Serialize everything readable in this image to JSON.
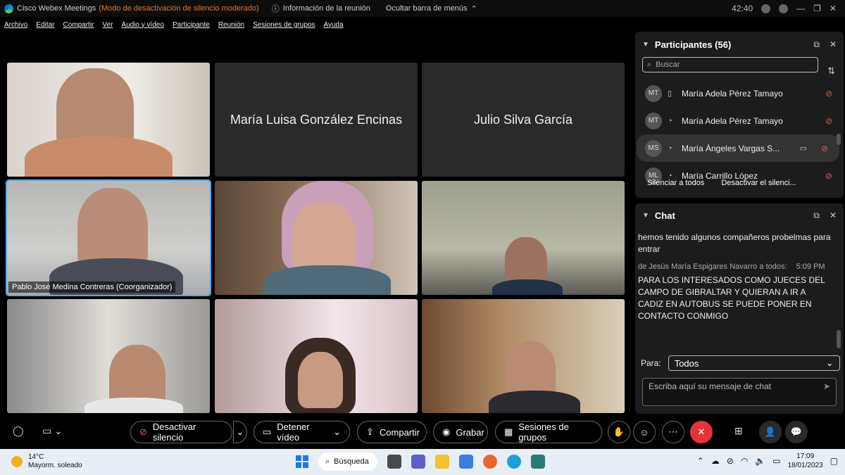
{
  "titlebar": {
    "app": "Cisco Webex Meetings",
    "mode": "(Modo de desactivación de silencio moderado)",
    "info": "Información de la reunión",
    "hide_menu": "Ocultar barra de menús",
    "timer": "42:40"
  },
  "menu": [
    "Archivo",
    "Editar",
    "Compartir",
    "Ver",
    "Audio y vídeo",
    "Participante",
    "Reunión",
    "Sesiones de grupos",
    "Ayuda"
  ],
  "tiles": {
    "t2_name": "María Luisa González Encinas",
    "t3_name": "Julio Silva García",
    "t4_label": "Pablo José Medina Contreras (Coorganizador)"
  },
  "participants": {
    "title": "Participantes (56)",
    "search_placeholder": "Buscar",
    "rows": [
      {
        "initials": "MT",
        "name": "María Adela Pérez Tamayo"
      },
      {
        "initials": "MT",
        "name": "María Adela Pérez Tamayo"
      },
      {
        "initials": "MS",
        "name": "María Ángeles Vargas S..."
      },
      {
        "initials": "ML",
        "name": "María Carrillo López"
      }
    ],
    "mute_all": "Silenciar a todos",
    "unmute_all": "Desactivar el silenci..."
  },
  "chat": {
    "title": "Chat",
    "msg1": "hemos tenido algunos compañeros probelmas para entrar",
    "sender": "de Jesús María Espigares Navarro a todos:",
    "time": "5:09 PM",
    "msg2": "PARA LOS INTERESADOS COMO JUECES DEL CAMPO DE GIBRALTAR Y QUIERAN A IR A CADIZ EN AUTOBUS SE PUEDE PONER EN CONTACTO CONMIGO",
    "to_label": "Para:",
    "to_value": "Todos",
    "input_placeholder": "Escriba aquí su mensaje de chat"
  },
  "controls": {
    "unmute": "Desactivar silencio",
    "stop_video": "Detener vídeo",
    "share": "Compartir",
    "record": "Grabar",
    "breakout": "Sesiones de grupos"
  },
  "taskbar": {
    "temp": "14°C",
    "weather": "Mayorm. soleado",
    "search": "Búsqueda",
    "time": "17:09",
    "date": "18/01/2023"
  },
  "colors": {
    "accent": "#5aa9e6",
    "leave": "#e3343a",
    "muted": "#e25c5c",
    "mode": "#e07a2e"
  }
}
